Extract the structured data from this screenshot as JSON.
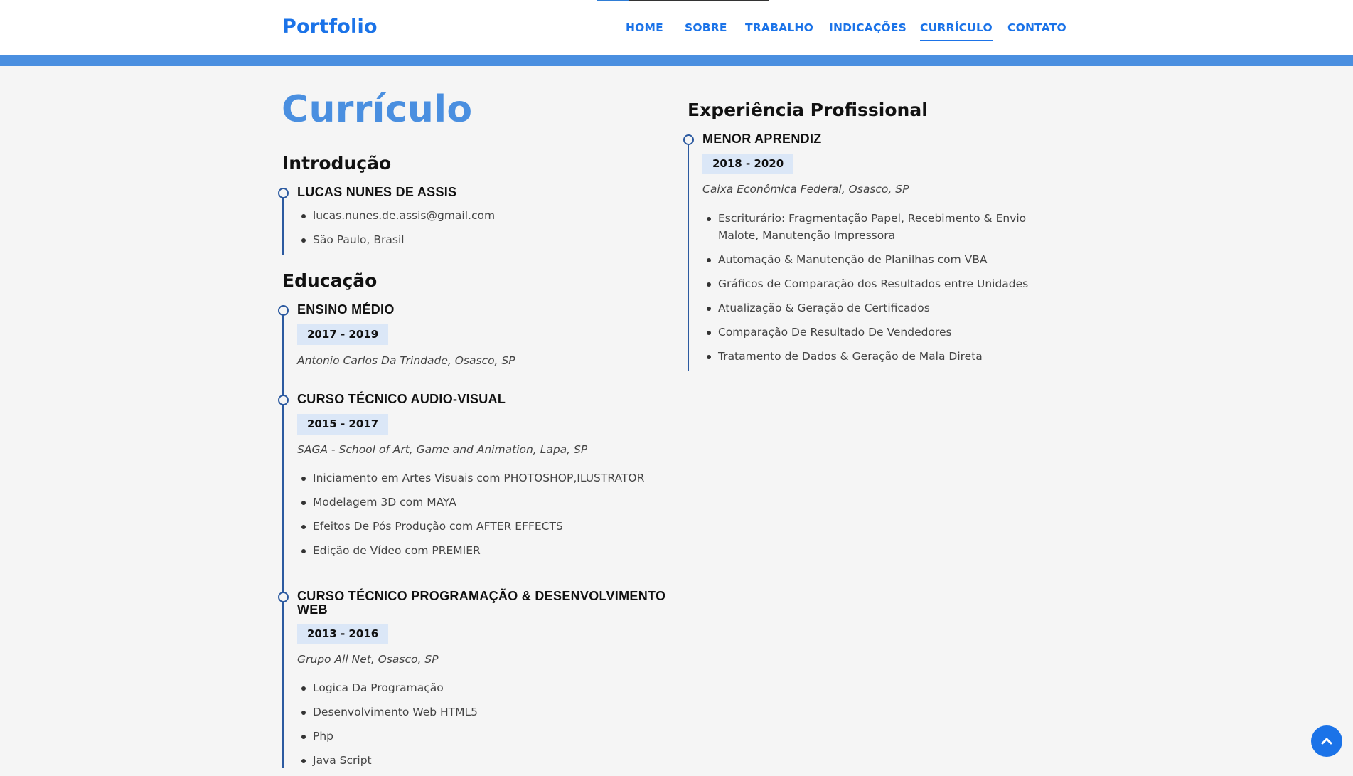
{
  "header": {
    "brand": "Portfolio",
    "nav": [
      {
        "label": "HOME",
        "active": false
      },
      {
        "label": "SOBRE",
        "active": false
      },
      {
        "label": "TRABALHO",
        "active": false
      },
      {
        "label": "INDICAÇÕES",
        "active": false
      },
      {
        "label": "CURRÍCULO",
        "active": true
      },
      {
        "label": "CONTATO",
        "active": false
      }
    ]
  },
  "main": {
    "page_title": "Currículo",
    "introducao": {
      "title": "Introdução",
      "name": "LUCAS NUNES DE ASSIS",
      "items": [
        "lucas.nunes.de.assis@gmail.com",
        "São Paulo, Brasil"
      ]
    },
    "educacao": {
      "title": "Educação",
      "entries": [
        {
          "title": "ENSINO MÉDIO",
          "date": "2017 - 2019",
          "place": "Antonio Carlos Da Trindade, Osasco, SP",
          "items": []
        },
        {
          "title": "CURSO TÉCNICO AUDIO-VISUAL",
          "date": "2015 - 2017",
          "place": "SAGA - School of Art, Game and Animation, Lapa, SP",
          "items": [
            "Iniciamento em Artes Visuais com PHOTOSHOP,ILUSTRATOR",
            "Modelagem 3D com MAYA",
            "Efeitos De Pós Produção com AFTER EFFECTS",
            "Edição de Vídeo com PREMIER"
          ]
        },
        {
          "title": "CURSO TÉCNICO PROGRAMAÇÃO & DESENVOLVIMENTO WEB",
          "date": "2013 - 2016",
          "place": "Grupo All Net, Osasco, SP",
          "items": [
            "Logica Da Programação",
            "Desenvolvimento Web HTML5",
            "Php",
            "Java Script"
          ]
        }
      ]
    },
    "experiencia": {
      "title": "Experiência Profissional",
      "entries": [
        {
          "title": "MENOR APRENDIZ",
          "date": "2018 - 2020",
          "place": "Caixa Econômica Federal, Osasco, SP",
          "items": [
            "Escriturário: Fragmentação Papel, Recebimento & Envio Malote, Manutenção Impressora",
            "Automação & Manutenção de Planilhas com VBA",
            "Gráficos de Comparação dos Resultados entre Unidades",
            "Atualização & Geração de Certificados",
            "Comparação De Resultado De Vendedores",
            "Tratamento de Dados & Geração de Mala Direta"
          ]
        }
      ]
    }
  },
  "colors": {
    "accent": "#1b73e8",
    "title_blue": "#4a8fe0",
    "timeline": "#2c5aa0",
    "badge_bg": "#dbe7f7"
  },
  "icons": {
    "back_to_top": "chevron-up-icon"
  }
}
